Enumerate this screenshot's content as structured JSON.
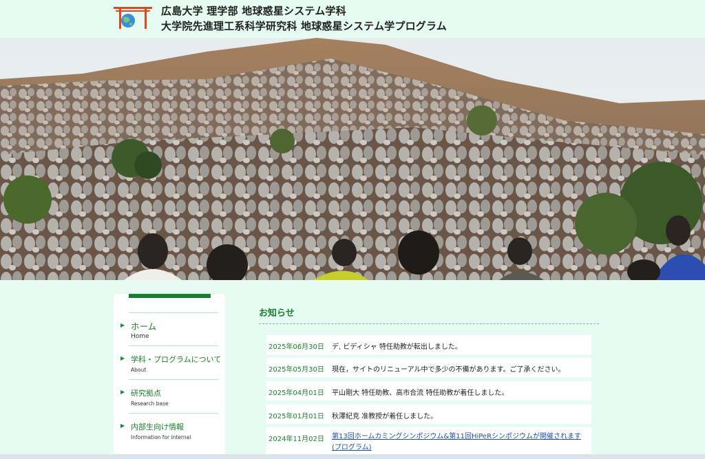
{
  "header": {
    "title_line1": "広島大学 理学部 地球惑星システム学科",
    "title_line2": "大学院先進理工系科学研究科 地球惑星システム学プログラム",
    "logo_icon": "torii-globe-icon"
  },
  "sidebar": {
    "items": [
      {
        "jp": "ホーム",
        "en": "Home"
      },
      {
        "jp": "学科・プログラムについて",
        "en": "About"
      },
      {
        "jp": "研究拠点",
        "en": "Research base"
      },
      {
        "jp": "内部生向け情報",
        "en": "Information for internal"
      }
    ]
  },
  "notices": {
    "title": "お知らせ",
    "items": [
      {
        "date": "2025年06月30日",
        "text": "デ, ビディシャ 特任助教が転出しました。",
        "link": false
      },
      {
        "date": "2025年05月30日",
        "text": "現在，サイトのリニューアル中で多少の不備があります。ご了承ください。",
        "link": false
      },
      {
        "date": "2025年04月01日",
        "text": "平山剛大 特任助教、高市合流 特任助教が着任しました。",
        "link": false
      },
      {
        "date": "2025年01月01日",
        "text": "秋澤紀克 准教授が着任しました。",
        "link": false
      },
      {
        "date": "2024年11月02日",
        "text": "第13回ホームカミングシンポジウム&第11回HiPeRシンポジウムが開催されます(プログラム)",
        "link": true
      }
    ]
  },
  "colors": {
    "background": "#e6fcf3",
    "accent_green": "#1a7f2e",
    "link_blue": "#1e4fb5"
  }
}
